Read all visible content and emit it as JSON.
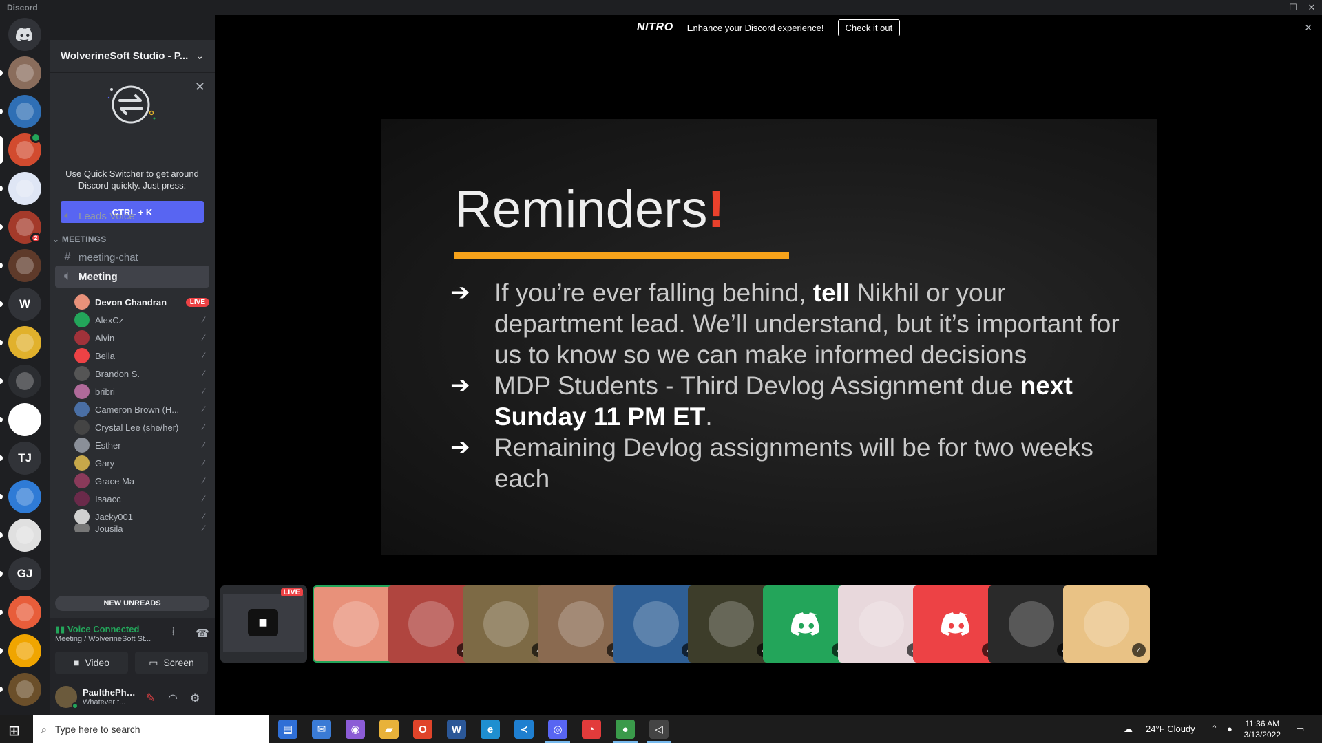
{
  "window": {
    "title": "Discord",
    "controls": [
      "—",
      "☐",
      "✕"
    ]
  },
  "rail": {
    "home_icon": "discord-logo-icon",
    "servers": [
      {
        "initials": "",
        "color": "#8a6d5c",
        "icon": "fox-server-icon"
      },
      {
        "initials": "",
        "color": "#2f6fb5",
        "icon": "yin-yang-server-icon"
      },
      {
        "initials": "",
        "color": "#d24b2f",
        "icon": "wolverine-server-icon",
        "active": true
      },
      {
        "initials": "",
        "color": "#dfe6f5",
        "icon": "pattern-server-icon"
      },
      {
        "initials": "",
        "color": "#a43a2a",
        "icon": "sunglasses-server-icon",
        "badge": "2"
      },
      {
        "initials": "",
        "color": "#5e3a2a",
        "icon": "mask-server-icon"
      },
      {
        "initials": "W",
        "color": "#313338"
      },
      {
        "initials": "",
        "color": "#e1b12c",
        "icon": "x-server-icon"
      },
      {
        "initials": "",
        "color": "#2b2d31",
        "icon": "helmet-server-icon"
      },
      {
        "initials": "",
        "color": "#ffffff",
        "icon": "r-server-icon"
      },
      {
        "initials": "TJ",
        "color": "#313338"
      },
      {
        "initials": "",
        "color": "#2f7bd6",
        "icon": "gear-bot-server-icon"
      },
      {
        "initials": "",
        "color": "#e0e0e0",
        "icon": "controller-server-icon"
      },
      {
        "initials": "GJ",
        "color": "#313338"
      },
      {
        "initials": "",
        "color": "#e85d3a",
        "icon": "book-server-icon"
      },
      {
        "initials": "",
        "color": "#f0a500",
        "icon": "m-server-icon"
      },
      {
        "initials": "",
        "color": "#6b4f2a",
        "icon": "bloom-server-icon"
      }
    ]
  },
  "sidebar": {
    "guild_name": "WolverineSoft Studio - P...",
    "quick_switcher": {
      "text": "Use Quick Switcher to get around Discord quickly. Just press:",
      "shortcut": "CTRL + K"
    },
    "channels_top": [
      {
        "name": "Leads Voice",
        "type": "voice"
      }
    ],
    "category": "MEETINGS",
    "channels": [
      {
        "name": "meeting-chat",
        "type": "text"
      },
      {
        "name": "Meeting",
        "type": "voice",
        "active": true
      }
    ],
    "voice_users": [
      {
        "name": "Devon Chandran",
        "live": "LIVE",
        "color": "#e8917a"
      },
      {
        "name": "AlexCz",
        "color": "#23a55a"
      },
      {
        "name": "Alvin",
        "color": "#a1323a"
      },
      {
        "name": "Bella",
        "color": "#ed4245"
      },
      {
        "name": "Brandon S.",
        "color": "#555555"
      },
      {
        "name": "bribri",
        "color": "#b06a9a"
      },
      {
        "name": "Cameron Brown (H...",
        "color": "#4a6fa5"
      },
      {
        "name": "Crystal Lee (she/her)",
        "color": "#444444"
      },
      {
        "name": "Esther",
        "color": "#8a8f98"
      },
      {
        "name": "Gary",
        "color": "#c7a84a"
      },
      {
        "name": "Grace Ma",
        "color": "#8a3a5a"
      },
      {
        "name": "Isaacc",
        "color": "#6a2a4a"
      },
      {
        "name": "Jacky001",
        "color": "#d0d0d0"
      },
      {
        "name": "Jousila",
        "color": "#777777"
      }
    ],
    "new_unreads": "NEW UNREADS",
    "voice_panel": {
      "status": "Voice Connected",
      "location": "Meeting / WolverineSoft St...",
      "video_label": "Video",
      "screen_label": "Screen"
    },
    "user_panel": {
      "name": "PaulthePhil...",
      "status": "Whatever t..."
    }
  },
  "nitro_banner": {
    "logo": "NITRO",
    "message": "Enhance your Discord experience!",
    "cta": "Check it out"
  },
  "slide": {
    "title": "Reminders",
    "bullets": [
      {
        "pre": "If you’re ever falling behind, ",
        "bold": "tell",
        "post": " Nikhil or your department lead. We’ll understand, but it’s important for us to know so we can make informed decisions"
      },
      {
        "pre": "MDP Students - Third Devlog Assignment due ",
        "bold": "next Sunday 11 PM ET",
        "post": "."
      },
      {
        "pre": "Remaining Devlog assignments will be for two weeks each",
        "bold": "",
        "post": ""
      }
    ]
  },
  "strip": {
    "live_label": "LIVE",
    "tiles": [
      {
        "color": "#e8917a",
        "icon": "bird-avatar-icon",
        "selected": true
      },
      {
        "color": "#b0453f",
        "icon": "spiderman-avatar-icon"
      },
      {
        "color": "#7d6a45",
        "icon": "landscape-avatar-icon"
      },
      {
        "color": "#8a6a50",
        "icon": "art-avatar-icon"
      },
      {
        "color": "#2f5f95",
        "icon": "planet-avatar-icon"
      },
      {
        "color": "#3d3d2a",
        "icon": "glasses-avatar-icon"
      },
      {
        "color": "#23a55a",
        "icon": "discord-avatar-icon"
      },
      {
        "color": "#e8d8dc",
        "icon": "helmet-avatar-icon"
      },
      {
        "color": "#ed4245",
        "icon": "discord-avatar-icon"
      },
      {
        "color": "#2a2a2a",
        "icon": "animal-avatar-icon"
      },
      {
        "color": "#e9c285",
        "icon": "girl-avatar-icon"
      }
    ]
  },
  "taskbar": {
    "search_placeholder": "Type here to search",
    "weather": "24°F  Cloudy",
    "time": "11:36 AM",
    "date": "3/13/2022",
    "apps": [
      {
        "icon": "store-icon",
        "color": "#2f6fd6",
        "glyph": "▤"
      },
      {
        "icon": "mail-icon",
        "color": "#3a7bd5",
        "glyph": "✉"
      },
      {
        "icon": "github-icon",
        "color": "#8c5cd6",
        "glyph": "◉"
      },
      {
        "icon": "folder-icon",
        "color": "#e8b23a",
        "glyph": "▰"
      },
      {
        "icon": "office-icon",
        "color": "#e0442a",
        "glyph": "O"
      },
      {
        "icon": "word-icon",
        "color": "#2b5797",
        "glyph": "W"
      },
      {
        "icon": "edge-icon",
        "color": "#1f8fd0",
        "glyph": "e"
      },
      {
        "icon": "vscode-icon",
        "color": "#1f7fd0",
        "glyph": "≺"
      },
      {
        "icon": "discord-taskbar-icon",
        "color": "#5865f2",
        "glyph": "◎",
        "active": true
      },
      {
        "icon": "steam-like-icon",
        "color": "#e23b3b",
        "glyph": "◔"
      },
      {
        "icon": "chrome-icon",
        "color": "#3a9a4a",
        "glyph": "●",
        "active": true
      },
      {
        "icon": "unity-icon",
        "color": "#444444",
        "glyph": "◁",
        "active": true
      }
    ]
  }
}
